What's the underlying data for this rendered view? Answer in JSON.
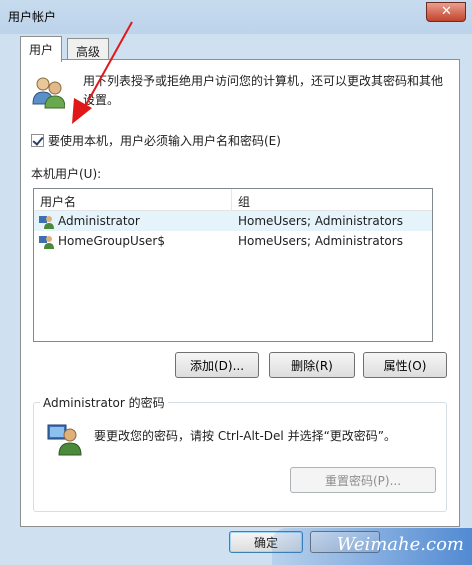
{
  "window": {
    "title": "用户帐户",
    "close_glyph": "✕"
  },
  "tabs": [
    {
      "label": "用户"
    },
    {
      "label": "高级"
    }
  ],
  "intro": {
    "text": "用下列表授予或拒绝用户访问您的计算机，还可以更改其密码和其他设置。"
  },
  "require_login": {
    "label": "要使用本机，用户必须输入用户名和密码(E)",
    "checked": true
  },
  "local_users": {
    "label": "本机用户(U):",
    "columns": [
      "用户名",
      "组"
    ],
    "rows": [
      {
        "name": "Administrator",
        "group": "HomeUsers; Administrators"
      },
      {
        "name": "HomeGroupUser$",
        "group": "HomeUsers; Administrators"
      }
    ]
  },
  "actions": {
    "add": "添加(D)...",
    "remove": "删除(R)",
    "properties": "属性(O)"
  },
  "password_group": {
    "title": "Administrator 的密码",
    "text": "要更改您的密码，请按 Ctrl-Alt-Del 并选择“更改密码”。",
    "reset": "重置密码(P)..."
  },
  "footer": {
    "ok": "确定"
  },
  "watermark": {
    "text": "Weimahe.com"
  },
  "colors": {
    "accent_arrow": "#e01818",
    "selection": "#e5f3fb"
  }
}
